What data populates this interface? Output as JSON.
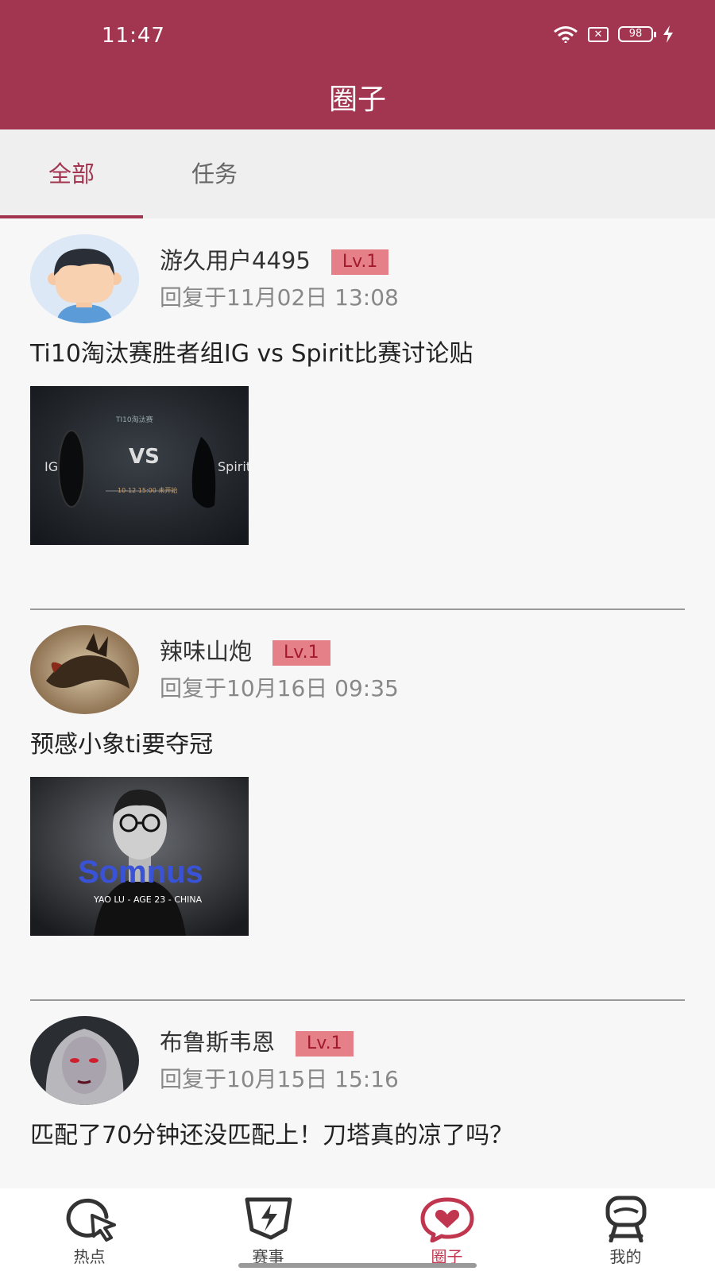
{
  "status_bar": {
    "time": "11:47",
    "battery": "98",
    "sim_icon": "sim-x-icon"
  },
  "header": {
    "title": "圈子"
  },
  "tabs": [
    {
      "label": "全部",
      "active": true
    },
    {
      "label": "任务",
      "active": false
    }
  ],
  "posts": [
    {
      "username": "游久用户4495",
      "level": "Lv.1",
      "reply_time": "回复于11月02日 13:08",
      "title": "Ti10淘汰赛胜者组IG vs Spirit比赛讨论贴",
      "image_text": {
        "top": "TI10淘汰赛",
        "left": "IG",
        "vs": "VS",
        "right": "Spirit",
        "sub": "10-12 15:00 未开始"
      }
    },
    {
      "username": "辣味山炮",
      "level": "Lv.1",
      "reply_time": "回复于10月16日 09:35",
      "title": "预感小象ti要夺冠",
      "image_text": {
        "name": "Somnus",
        "sub": "YAO LU - AGE 23 - CHINA"
      }
    },
    {
      "username": "布鲁斯韦恩",
      "level": "Lv.1",
      "reply_time": "回复于10月15日 15:16",
      "title": "匹配了70分钟还没匹配上！刀塔真的凉了吗？"
    }
  ],
  "bottom_nav": [
    {
      "label": "热点",
      "icon": "hotspot-icon",
      "active": false
    },
    {
      "label": "赛事",
      "icon": "match-icon",
      "active": false
    },
    {
      "label": "圈子",
      "icon": "circle-heart-icon",
      "active": true
    },
    {
      "label": "我的",
      "icon": "profile-icon",
      "active": false
    }
  ],
  "colors": {
    "brand": "#a23650",
    "level_badge": "#e58089",
    "active_nav": "#c0364f"
  }
}
